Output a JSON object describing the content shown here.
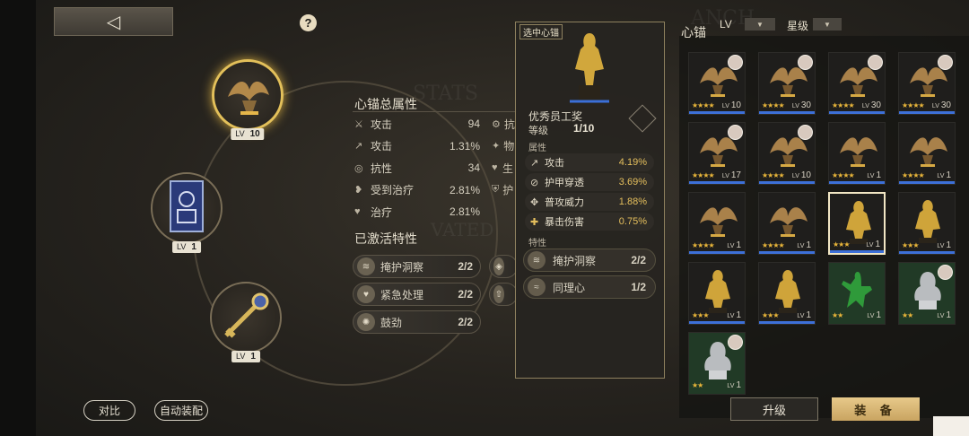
{
  "back_button": {
    "icon": "back-arrow-icon",
    "glyph": "◁"
  },
  "help_button": {
    "label": "?"
  },
  "slots": [
    {
      "level_label": "LV",
      "level": "10",
      "active": true,
      "item": "winged-trophy"
    },
    {
      "level_label": "LV",
      "level": "1",
      "active": false,
      "item": "tarot-card"
    },
    {
      "level_label": "LV",
      "level": "1",
      "active": false,
      "item": "key"
    }
  ],
  "stats": {
    "title": "心锚总属性",
    "rows": [
      {
        "icon": "sword-icon",
        "name": "攻击",
        "value": "94"
      },
      {
        "icon": "sword-up-icon",
        "name": "攻击",
        "value": "1.31%"
      },
      {
        "icon": "shield-icon",
        "name": "抗性",
        "value": "34"
      },
      {
        "icon": "heart-plus-icon",
        "name": "受到治疗",
        "value": "2.81%"
      },
      {
        "icon": "heart-icon",
        "name": "治疗",
        "value": "2.81%"
      }
    ],
    "col2": [
      {
        "name": "抗"
      },
      {
        "name": "物"
      },
      {
        "name": "生"
      },
      {
        "name": "护"
      }
    ]
  },
  "activated_traits": {
    "title": "已激活特性",
    "items": [
      {
        "name": "掩护洞察",
        "count": "2/2"
      },
      {
        "name": "紧急处理",
        "count": "2/2"
      },
      {
        "name": "鼓劲",
        "count": "2/2"
      }
    ]
  },
  "popover": {
    "tag": "选中心锚",
    "name": "优秀员工奖",
    "level_label": "等级",
    "level_value": "1/10",
    "props_label": "属性",
    "props": [
      {
        "icon": "sword-up-icon",
        "name": "攻击",
        "value": "4.19%"
      },
      {
        "icon": "pierce-icon",
        "name": "护甲穿透",
        "value": "3.69%"
      },
      {
        "icon": "crosshair-icon",
        "name": "普攻威力",
        "value": "1.88%"
      },
      {
        "icon": "crit-icon",
        "name": "暴击伤害",
        "value": "0.75%"
      }
    ],
    "traits_label": "特性",
    "traits": [
      {
        "name": "掩护洞察",
        "count": "2/2"
      },
      {
        "name": "同理心",
        "count": "1/2"
      }
    ]
  },
  "inventory": {
    "title": "心锚",
    "sort_label": "LV",
    "star_label": "星级",
    "items": [
      {
        "kind": "wing",
        "level": "10",
        "stars": "★★★★",
        "avatar": true,
        "green": false,
        "selected": false
      },
      {
        "kind": "wing",
        "level": "30",
        "stars": "★★★★",
        "avatar": true,
        "green": false,
        "selected": false
      },
      {
        "kind": "wing",
        "level": "30",
        "stars": "★★★★",
        "avatar": true,
        "green": false,
        "selected": false
      },
      {
        "kind": "wing",
        "level": "30",
        "stars": "★★★★",
        "avatar": true,
        "green": false,
        "selected": false
      },
      {
        "kind": "wing",
        "level": "17",
        "stars": "★★★★",
        "avatar": true,
        "green": false,
        "selected": false
      },
      {
        "kind": "wing",
        "level": "10",
        "stars": "★★★★",
        "avatar": true,
        "green": false,
        "selected": false
      },
      {
        "kind": "wing",
        "level": "1",
        "stars": "★★★★",
        "avatar": false,
        "green": false,
        "selected": false
      },
      {
        "kind": "wing",
        "level": "1",
        "stars": "★★★★",
        "avatar": false,
        "green": false,
        "selected": false
      },
      {
        "kind": "wing",
        "level": "1",
        "stars": "★★★★",
        "avatar": false,
        "green": false,
        "selected": false
      },
      {
        "kind": "wing",
        "level": "1",
        "stars": "★★★★",
        "avatar": false,
        "green": false,
        "selected": false
      },
      {
        "kind": "statue",
        "level": "1",
        "stars": "★★★",
        "avatar": false,
        "green": false,
        "selected": true
      },
      {
        "kind": "statue",
        "level": "1",
        "stars": "★★★",
        "avatar": false,
        "green": false,
        "selected": false
      },
      {
        "kind": "statue",
        "level": "1",
        "stars": "★★★",
        "avatar": false,
        "green": false,
        "selected": false
      },
      {
        "kind": "statue",
        "level": "1",
        "stars": "★★★",
        "avatar": false,
        "green": false,
        "selected": false
      },
      {
        "kind": "dancer",
        "level": "1",
        "stars": "★★",
        "avatar": false,
        "green": true,
        "selected": false
      },
      {
        "kind": "bust",
        "level": "1",
        "stars": "★★",
        "avatar": true,
        "green": true,
        "selected": false
      },
      {
        "kind": "bust",
        "level": "1",
        "stars": "★★",
        "avatar": true,
        "green": true,
        "selected": false
      }
    ]
  },
  "buttons": {
    "compare": "对比",
    "auto_equip": "自动装配",
    "upgrade": "升级",
    "equip": "装 备"
  },
  "colors": {
    "gold": "#e3c05a",
    "highlight": "#e5bf5d",
    "blue_bar": "#3d70d8",
    "equip_bg": "#dcbc7c"
  }
}
